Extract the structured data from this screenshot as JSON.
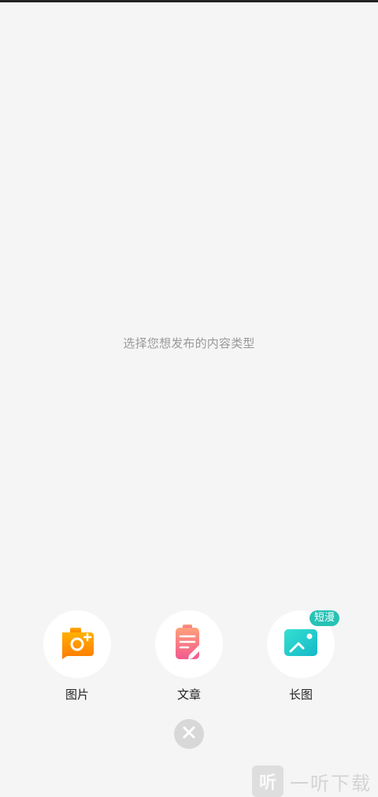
{
  "prompt_text": "选择您想发布的内容类型",
  "options": [
    {
      "label": "图片",
      "icon": "camera-icon"
    },
    {
      "label": "文章",
      "icon": "article-edit-icon"
    },
    {
      "label": "长图",
      "icon": "image-icon",
      "badge": "短漫"
    }
  ],
  "close": {
    "icon": "close-icon"
  },
  "watermark": {
    "glyph": "听",
    "text": "一听下载"
  },
  "colors": {
    "background": "#f5f5f5",
    "badge": "#27c2b5",
    "camera": "#ff8a00",
    "article": "#f06a8a",
    "image": "#20d0c0",
    "close": "#d8d8d8"
  }
}
